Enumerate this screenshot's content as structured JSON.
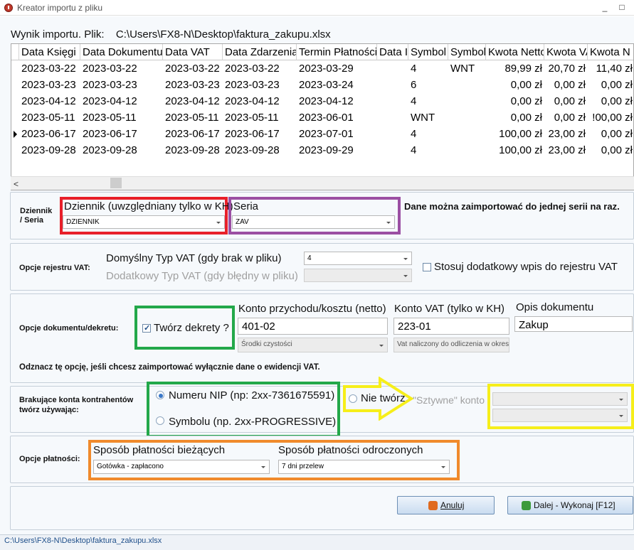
{
  "window": {
    "title": "Kreator importu z pliku",
    "minimize": "_",
    "maximize": "□"
  },
  "file": {
    "label": "Wynik importu. Plik:",
    "path": "C:\\Users\\FX8-N\\Desktop\\faktura_zakupu.xlsx"
  },
  "table": {
    "columns": [
      "Data Księgi",
      "Data Dokumentu",
      "Data VAT",
      "Data Zdarzenia",
      "Termin Płatności",
      "Data I",
      "Symbol",
      "Symbol",
      "Kwota Netto",
      "Kwota VA",
      "Kwota N"
    ],
    "rows": [
      [
        "2023-03-22",
        "2023-03-22",
        "2023-03-22",
        "2023-03-22",
        "2023-03-29",
        "",
        "4",
        "WNT",
        "89,99 zł",
        "20,70 zł",
        "11,40 zł"
      ],
      [
        "2023-03-23",
        "2023-03-23",
        "2023-03-23",
        "2023-03-23",
        "2023-03-24",
        "",
        "6",
        "",
        "0,00 zł",
        "0,00 zł",
        "0,00 zł"
      ],
      [
        "2023-04-12",
        "2023-04-12",
        "2023-04-12",
        "2023-04-12",
        "2023-04-12",
        "",
        "4",
        "",
        "0,00 zł",
        "0,00 zł",
        "0,00 zł"
      ],
      [
        "2023-05-11",
        "2023-05-11",
        "2023-05-11",
        "2023-05-11",
        "2023-06-01",
        "",
        "WNT",
        "",
        "0,00 zł",
        "0,00 zł",
        "!00,00 zł"
      ],
      [
        "2023-06-17",
        "2023-06-17",
        "2023-06-17",
        "2023-06-17",
        "2023-07-01",
        "",
        "4",
        "",
        "100,00 zł",
        "23,00 zł",
        "0,00 zł"
      ],
      [
        "2023-09-28",
        "2023-09-28",
        "2023-09-28",
        "2023-09-28",
        "2023-09-29",
        "",
        "4",
        "",
        "100,00 zł",
        "23,00 zł",
        "0,00 zł"
      ]
    ],
    "current_row": 4,
    "scroll_left": "<"
  },
  "journal": {
    "group_label": "Dziennik\n/ Seria",
    "dziennik_label": "Dziennik (uwzględniany tylko w KH)",
    "dziennik_value": "DZIENNIK",
    "seria_label": "Seria",
    "seria_value": "ZAV",
    "note": "Dane można zaimportować do jednej serii na raz."
  },
  "vat": {
    "group_label": "Opcje rejestru VAT:",
    "default_type_label": "Domyślny Typ VAT (gdy brak w pliku)",
    "default_type_value": "4",
    "extra_type_label": "Dodatkowy Typ VAT (gdy błędny w pliku)",
    "extra_type_value": "",
    "extra_entry_label": "Stosuj dodatkowy wpis do rejestru VAT",
    "extra_entry_checked": false
  },
  "doc": {
    "group_label": "Opcje dokumentu/dekretu:",
    "create_decrees_label": "Twórz dekrety ?",
    "create_decrees_checked": true,
    "income_account_label": "Konto przychodu/kosztu (netto)",
    "income_account_value": "401-02",
    "income_account_name": "Środki czystości",
    "vat_account_label": "Konto VAT (tylko w KH)",
    "vat_account_value": "223-01",
    "vat_account_name": "Vat naliczony do odliczenia w okresie",
    "description_label": "Opis dokumentu",
    "description_value": "Zakup",
    "hint": "Odznacz tę opcję, jeśli chcesz zaimportować wyłącznie dane o ewidencji VAT."
  },
  "contractors": {
    "group_label": "Brakujące konta kontrahentów\ntwórz używając:",
    "nip_label": "Numeru NIP (np: 2xx-7361675591)",
    "symbol_label": "Symbolu (np. 2xx-PROGRESSIVE)",
    "none_label": "Nie twórz",
    "fixed_label": "\"Sztywne\" konto",
    "selected": "nip"
  },
  "payment": {
    "group_label": "Opcje płatności:",
    "current_label": "Sposób płatności bieżących",
    "current_value": "Gotówka - zapłacono",
    "deferred_label": "Sposób płatności odroczonych",
    "deferred_value": "7 dni przelew"
  },
  "buttons": {
    "cancel": "Anuluj",
    "next": "Dalej - Wykonaj [F12]"
  },
  "status": {
    "path": "C:\\Users\\FX8-N\\Desktop\\faktura_zakupu.xlsx"
  },
  "colors": {
    "red": "#e8202a",
    "purple": "#9b4fa3",
    "green": "#23a84a",
    "yellow": "#f6ee1a",
    "orange": "#f08a2c",
    "accent": "#3a78c8"
  }
}
